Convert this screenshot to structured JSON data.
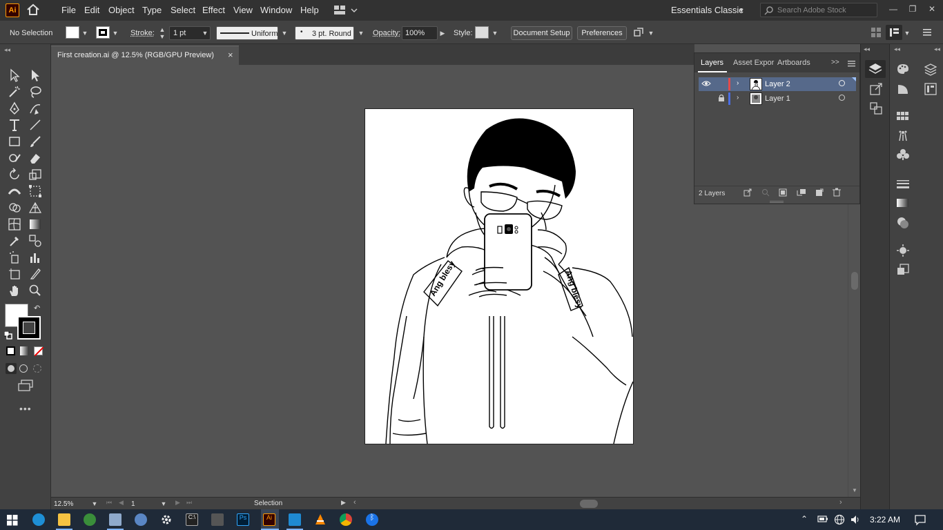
{
  "app": {
    "logo": "Ai",
    "accent": "#ff9a00",
    "bg_dark": "#323232"
  },
  "menu": {
    "items": [
      "File",
      "Edit",
      "Object",
      "Type",
      "Select",
      "Effect",
      "View",
      "Window",
      "Help"
    ]
  },
  "workspace": {
    "name": "Essentials Classic"
  },
  "search": {
    "placeholder": "Search Adobe Stock"
  },
  "control_bar": {
    "selection_state": "No Selection",
    "stroke_label": "Stroke:",
    "stroke_weight": "1 pt",
    "stroke_profile": "Uniform",
    "brush": "3 pt. Round",
    "opacity_label": "Opacity:",
    "opacity_value": "100%",
    "style_label": "Style:",
    "document_setup": "Document Setup",
    "preferences": "Preferences"
  },
  "document_tab": {
    "title": "First creation.ai @ 12.5% (RGB/GPU Preview)",
    "close": "×"
  },
  "layers_panel": {
    "tabs": [
      "Layers",
      "Asset Expor",
      "Artboards"
    ],
    "layers": [
      {
        "name": "Layer 2",
        "color": "#e34b4b",
        "selected": true,
        "visible": true,
        "locked": false
      },
      {
        "name": "Layer 1",
        "color": "#4b6ee3",
        "selected": false,
        "visible": false,
        "locked": true
      }
    ],
    "footer_count": "2 Layers"
  },
  "status_bar": {
    "zoom": "12.5%",
    "artboard_number": "1",
    "current_tool": "Selection"
  },
  "taskbar": {
    "time": "3:22 AM"
  },
  "artwork": {
    "hoodie_text": "Ang blesy"
  }
}
